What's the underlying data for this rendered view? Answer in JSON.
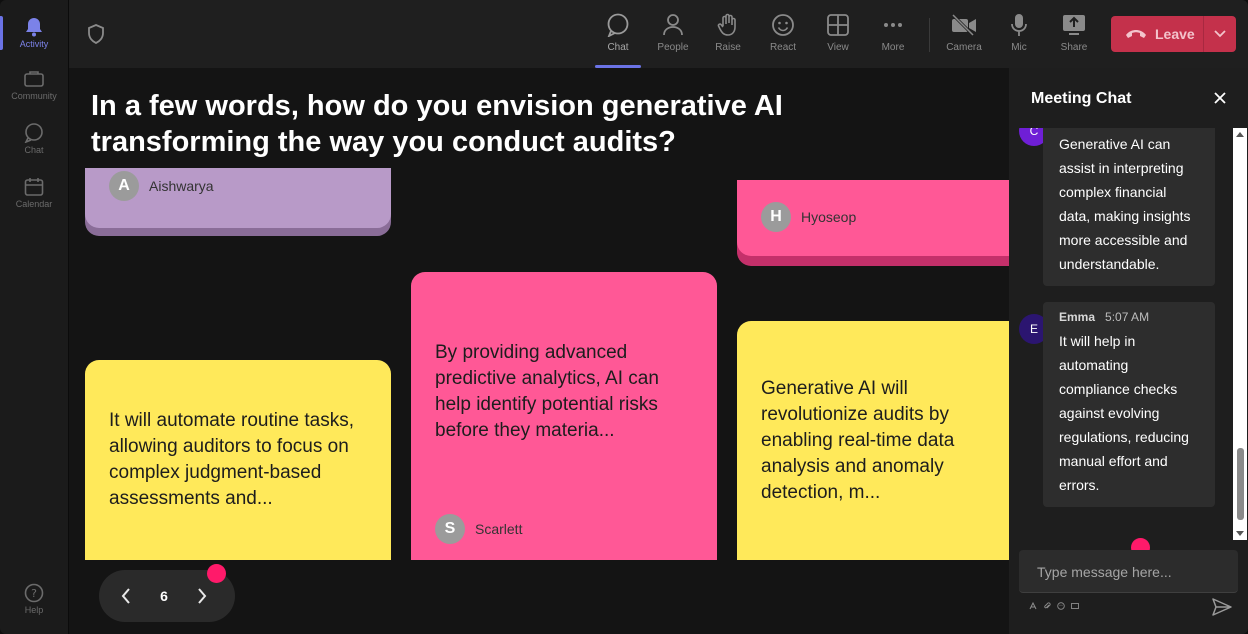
{
  "rail": {
    "items": [
      {
        "label": "Activity",
        "icon": "bell-icon"
      },
      {
        "label": "Community",
        "icon": "community-icon"
      },
      {
        "label": "Chat",
        "icon": "chat-icon"
      },
      {
        "label": "Calendar",
        "icon": "calendar-icon"
      }
    ],
    "help": "Help"
  },
  "toolbar": {
    "chat": "Chat",
    "people": "People",
    "raise": "Raise",
    "react": "React",
    "view": "View",
    "more": "More",
    "camera": "Camera",
    "mic": "Mic",
    "share": "Share",
    "leave": "Leave"
  },
  "stage": {
    "question": "In a few words, how do you envision generative AI transforming the way you conduct audits?",
    "cards": [
      {
        "author": "Aishwarya",
        "initial": "A",
        "text": ""
      },
      {
        "author": "Hyoseop",
        "initial": "H",
        "text": ""
      },
      {
        "author": "",
        "initial": "",
        "text": "It will automate routine tasks, allowing auditors to focus on complex judgment-based assessments and..."
      },
      {
        "author": "Scarlett",
        "initial": "S",
        "text": "By providing advanced predictive analytics, AI can help identify potential risks before they materia..."
      },
      {
        "author": "",
        "initial": "",
        "text": "Generative AI will revolutionize audits by enabling real-time data analysis and anomaly detection, m..."
      }
    ],
    "page": "6"
  },
  "chat": {
    "title": "Meeting Chat",
    "messages": [
      {
        "initial": "C",
        "name": "",
        "time": "",
        "text": "Generative AI can assist in interpreting complex financial data, making insights more accessible and understandable.",
        "color": "#6f1fd6"
      },
      {
        "initial": "E",
        "name": "Emma",
        "time": "5:07 AM",
        "text": "It will help in automating compliance checks against evolving regulations, reducing manual effort and errors.",
        "color": "#2b1570"
      }
    ],
    "placeholder": "Type message here..."
  },
  "colors": {
    "accent": "#6b73e6",
    "leave": "#c4314b",
    "card_purple": "#b89ac8",
    "card_pink": "#ff5896",
    "card_yellow": "#ffe95a",
    "dot": "#ff1a6a"
  }
}
